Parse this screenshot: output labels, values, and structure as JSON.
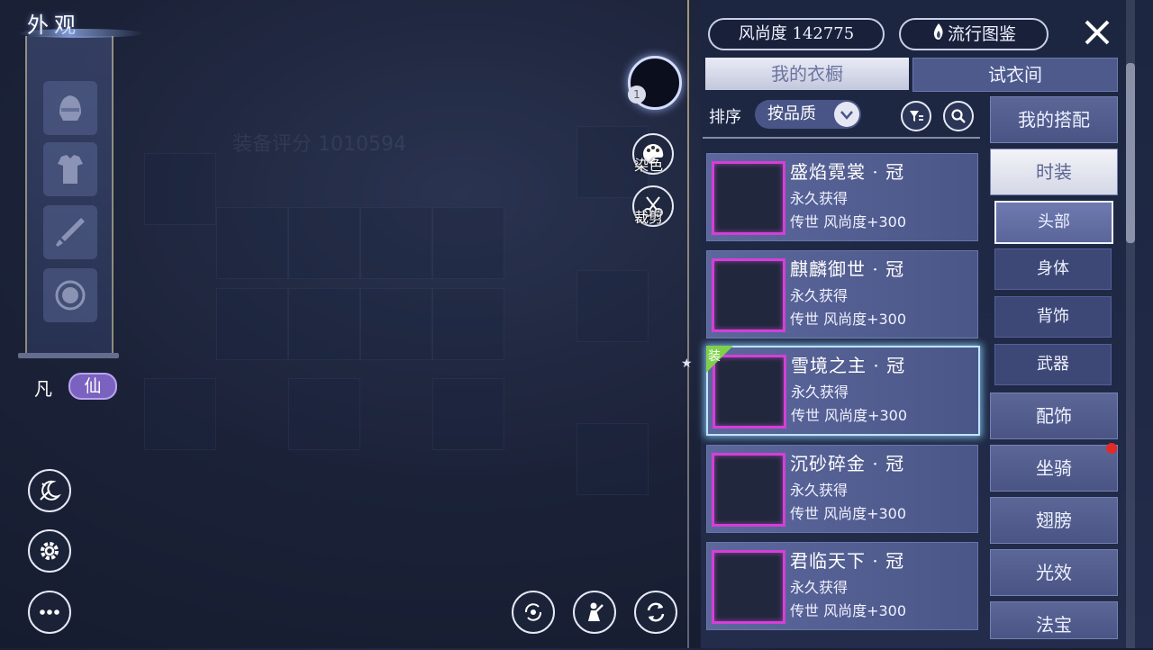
{
  "header": {
    "title": "外观"
  },
  "mode_toggle": {
    "mortal": "凡",
    "immortal": "仙"
  },
  "center": {
    "avatar_badge": "1",
    "dye_label": "染色",
    "tailor_label": "裁剪"
  },
  "top_bar": {
    "fashion_score": "风尚度 142775",
    "trend_guide": "流行图鉴"
  },
  "tabs": [
    {
      "label": "我的衣橱",
      "active": true
    },
    {
      "label": "试衣间",
      "active": false
    }
  ],
  "sort": {
    "label": "排序",
    "value": "按品质"
  },
  "items": [
    {
      "name": "盛焰霓裳 · 冠",
      "permanence": "永久获得",
      "attribute": "传世 风尚度+300",
      "equipped": false,
      "selected": false
    },
    {
      "name": "麒麟御世 · 冠",
      "permanence": "永久获得",
      "attribute": "传世 风尚度+300",
      "equipped": false,
      "selected": false
    },
    {
      "name": "雪境之主 · 冠",
      "permanence": "永久获得",
      "attribute": "传世 风尚度+300",
      "equipped": true,
      "selected": true
    },
    {
      "name": "沉砂碎金 · 冠",
      "permanence": "永久获得",
      "attribute": "传世 风尚度+300",
      "equipped": false,
      "selected": false
    },
    {
      "name": "君临天下 · 冠",
      "permanence": "永久获得",
      "attribute": "传世 风尚度+300",
      "equipped": false,
      "selected": false
    }
  ],
  "equip_flag": "装",
  "categories": {
    "my_outfits": "我的搭配",
    "fashion": "时装",
    "sub": [
      "头部",
      "身体",
      "背饰",
      "武器"
    ],
    "accessories": "配饰",
    "mount": "坐骑",
    "wings": "翅膀",
    "light_effect": "光效",
    "treasure": "法宝"
  },
  "background_text": {
    "equip_score": "装备评分 1010594"
  },
  "colors": {
    "accent_purple": "#7b62c0",
    "item_border_magenta": "#d43fd8",
    "selected_glow": "#bfe4ff",
    "notification_red": "#e22a2a",
    "equip_flag_green": "#7fd04a"
  },
  "icons": [
    "helmet-icon",
    "armor-icon",
    "sword-icon",
    "orb-icon",
    "day-night-icon",
    "gear-icon",
    "more-icon",
    "rotate-icon",
    "pose-icon",
    "refresh-icon",
    "palette-icon",
    "scissors-icon",
    "close-icon",
    "filter-icon",
    "search-icon",
    "chevron-down-icon",
    "flame-icon"
  ]
}
